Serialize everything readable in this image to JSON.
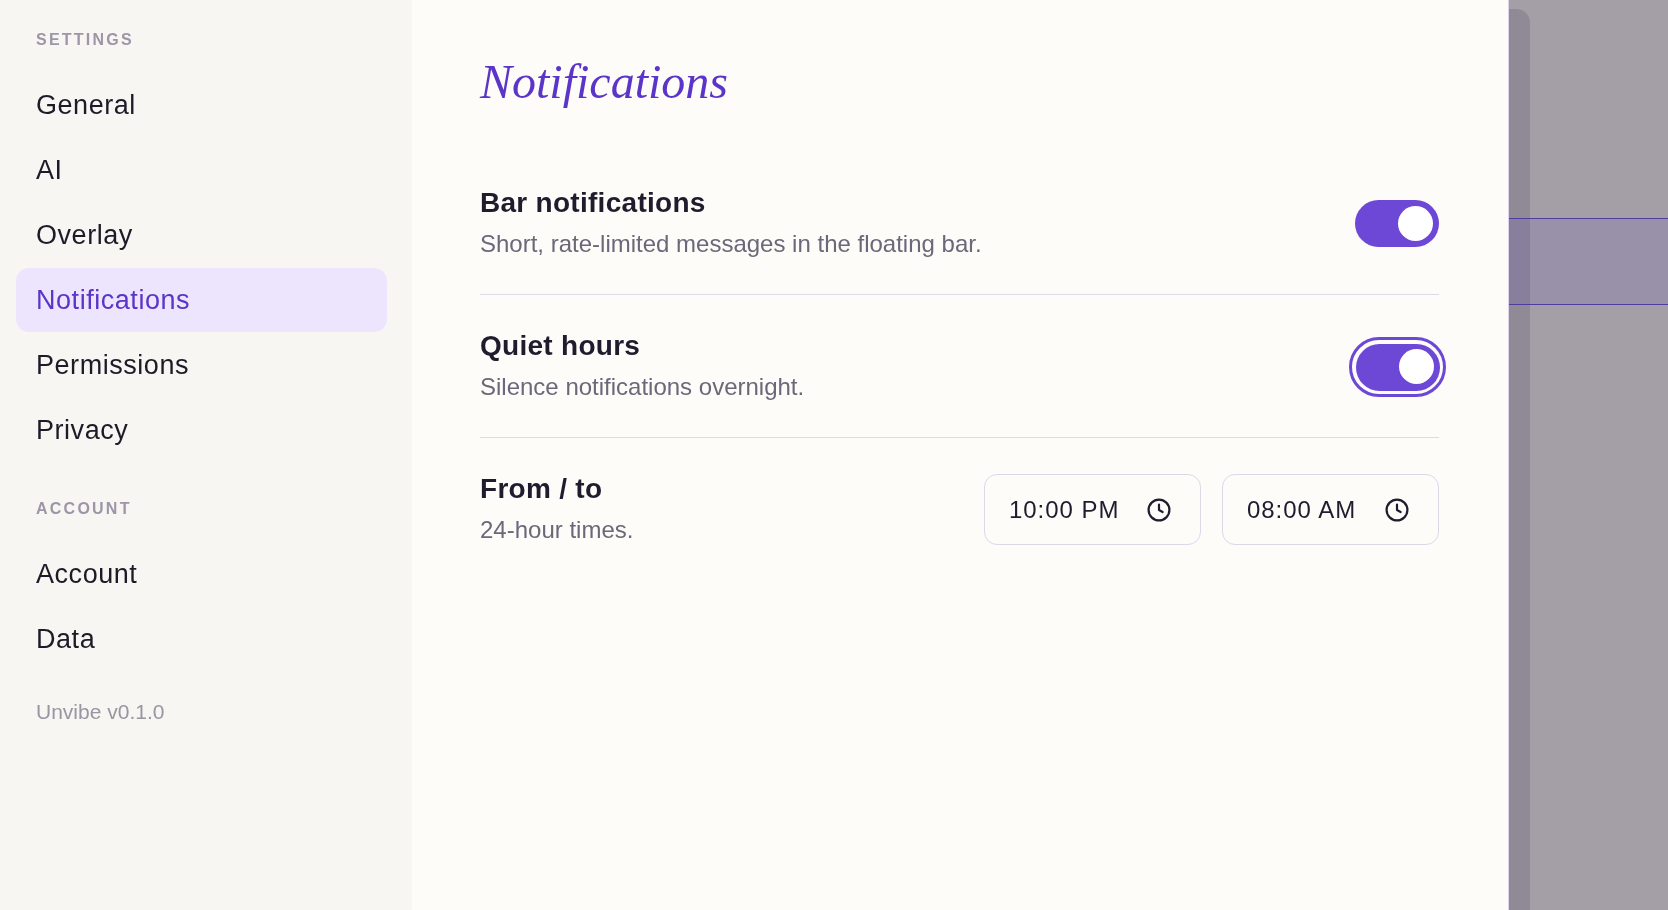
{
  "sidebar": {
    "sections": [
      {
        "heading": "SETTINGS",
        "items": [
          {
            "label": "General",
            "selected": false
          },
          {
            "label": "AI",
            "selected": false
          },
          {
            "label": "Overlay",
            "selected": false
          },
          {
            "label": "Notifications",
            "selected": true
          },
          {
            "label": "Permissions",
            "selected": false
          },
          {
            "label": "Privacy",
            "selected": false
          }
        ]
      },
      {
        "heading": "ACCOUNT",
        "items": [
          {
            "label": "Account",
            "selected": false
          },
          {
            "label": "Data",
            "selected": false
          }
        ]
      }
    ],
    "version": "Unvibe v0.1.0"
  },
  "page": {
    "title": "Notifications",
    "settings": [
      {
        "kind": "toggle",
        "title": "Bar notifications",
        "description": "Short, rate-limited messages in the floating bar.",
        "on": true,
        "focused": false
      },
      {
        "kind": "toggle",
        "title": "Quiet hours",
        "description": "Silence notifications overnight.",
        "on": true,
        "focused": true
      },
      {
        "kind": "time_range",
        "title": "From / to",
        "description": "24-hour times.",
        "times": [
          {
            "value": "10:00 PM"
          },
          {
            "value": "08:00 AM"
          }
        ]
      }
    ]
  }
}
